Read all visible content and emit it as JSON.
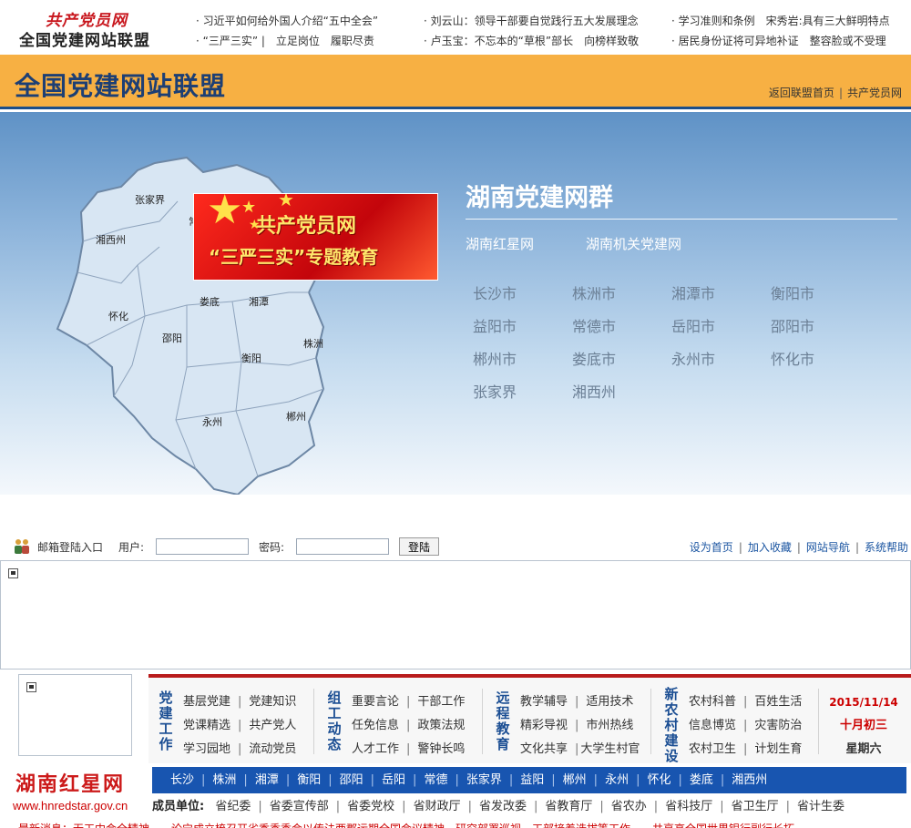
{
  "header": {
    "logo_script": "共产党员网",
    "logo_text": "全国党建网站联盟",
    "news": [
      [
        "习近平如何给外国人介绍“五中全会”",
        "“三严三实” |　立足岗位　履职尽责"
      ],
      [
        "刘云山：领导干部要自觉践行五大发展理念",
        "卢玉宝：不忘本的“草根”部长　向榜样致敬"
      ],
      [
        "学习准则和条例　宋秀岩:具有三大鲜明特点",
        "居民身份证将可异地补证　整容脸或不受理"
      ]
    ]
  },
  "alliance": {
    "title": "全国党建网站联盟",
    "links": [
      "返回联盟首页",
      "共产党员网"
    ]
  },
  "banner": {
    "promo_line1": "共产党员网",
    "promo_line2": "“三严三实”专题教育",
    "map_regions": [
      "张家界",
      "湘西州",
      "常德",
      "怀化",
      "娄底",
      "湘潭",
      "邵阳",
      "衡阳",
      "株洲",
      "永州",
      "郴州"
    ],
    "title": "湖南党建网群",
    "sites": [
      "湖南红星网",
      "湖南机关党建网"
    ],
    "cities": [
      "长沙市",
      "株洲市",
      "湘潭市",
      "衡阳市",
      "益阳市",
      "常德市",
      "岳阳市",
      "邵阳市",
      "郴州市",
      "娄底市",
      "永州市",
      "怀化市",
      "张家界",
      "湘西州"
    ]
  },
  "login": {
    "label": "邮箱登陆入口",
    "user_label": "用户:",
    "password_label": "密码:",
    "user_value": "",
    "password_value": "",
    "button": "登陆",
    "links": [
      "设为首页",
      "加入收藏",
      "网站导航",
      "系统帮助"
    ]
  },
  "redstar": {
    "logo": "湖南红星网",
    "url": "www.hnredstar.gov.cn"
  },
  "channels": [
    {
      "title": "党建工作",
      "links": [
        [
          "基层党建",
          "党建知识"
        ],
        [
          "党课精选",
          "共产党人"
        ],
        [
          "学习园地",
          "流动党员"
        ]
      ]
    },
    {
      "title": "组工动态",
      "links": [
        [
          "重要言论",
          "干部工作"
        ],
        [
          "任免信息",
          "政策法规"
        ],
        [
          "人才工作",
          "警钟长鸣"
        ]
      ]
    },
    {
      "title": "远程教育",
      "links": [
        [
          "教学辅导",
          "适用技术"
        ],
        [
          "精彩导视",
          "市州热线"
        ],
        [
          "文化共享",
          "大学生村官"
        ]
      ]
    },
    {
      "title": "新农村建设",
      "links": [
        [
          "农村科普",
          "百姓生活"
        ],
        [
          "信息博览",
          "灾害防治"
        ],
        [
          "农村卫生",
          "计划生育"
        ]
      ]
    }
  ],
  "date": {
    "gregorian": "2015/11/14",
    "lunar": "十月初三",
    "weekday": "星期六"
  },
  "city_strip": [
    "长沙",
    "株洲",
    "湘潭",
    "衡阳",
    "邵阳",
    "岳阳",
    "常德",
    "张家界",
    "益阳",
    "郴州",
    "永州",
    "怀化",
    "娄底",
    "湘西州"
  ],
  "members": {
    "lead": "成员单位:",
    "units": [
      "省纪委",
      "省委宣传部",
      "省委党校",
      "省财政厅",
      "省发改委",
      "省教育厅",
      "省农办",
      "省科技厅",
      "省卫生厅",
      "省计生委"
    ]
  },
  "ticker": "最新消息：无工中会全精神　　论宁成立梳召开省秀季季会以传法两郡运期全国会议精神　研究部署巡视　工部接着选拔等工作　　共享高全国世界银行副行长拓"
}
